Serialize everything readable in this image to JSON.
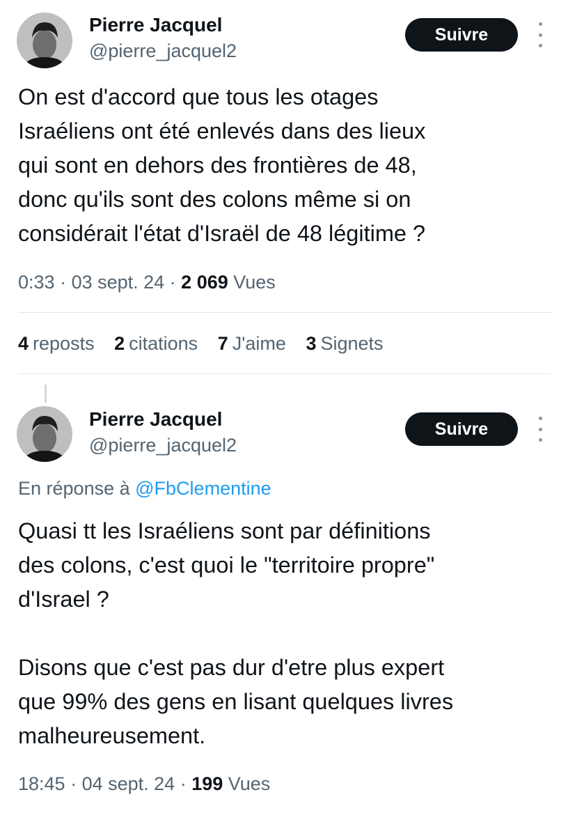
{
  "tweets": [
    {
      "author_name": "Pierre Jacquel",
      "author_handle": "@pierre_jacquel2",
      "follow_label": "Suivre",
      "text": "On est d'accord que tous les otages\nIsraéliens ont été enlevés dans des lieux\nqui sont en dehors des frontières de 48,\ndonc qu'ils sont des colons même si on\nconsidérait l'état d'Israël de 48 légitime ?",
      "time": "0:33",
      "date": "03 sept. 24",
      "views_count": "2 069",
      "views_label": "Vues",
      "stats": [
        {
          "count": "4",
          "label": "reposts"
        },
        {
          "count": "2",
          "label": "citations"
        },
        {
          "count": "7",
          "label": "J'aime"
        },
        {
          "count": "3",
          "label": "Signets"
        }
      ]
    },
    {
      "author_name": "Pierre Jacquel",
      "author_handle": "@pierre_jacquel2",
      "follow_label": "Suivre",
      "reply_prefix": "En réponse à",
      "reply_handle": "@FbClementine",
      "text": "Quasi tt les Israéliens sont par définitions\ndes colons, c'est quoi le \"territoire propre\"\nd'Israel ?\n\nDisons que c'est pas dur d'etre plus expert\nque 99% des gens en lisant quelques livres\nmalheureusement.",
      "time": "18:45",
      "date": "04 sept. 24",
      "views_count": "199",
      "views_label": "Vues"
    }
  ],
  "icons": {
    "more": "more-vertical-icon",
    "avatar": "profile-avatar"
  },
  "colors": {
    "button_bg": "#0f1419",
    "link": "#1d9bf0",
    "secondary_text": "#536471"
  }
}
